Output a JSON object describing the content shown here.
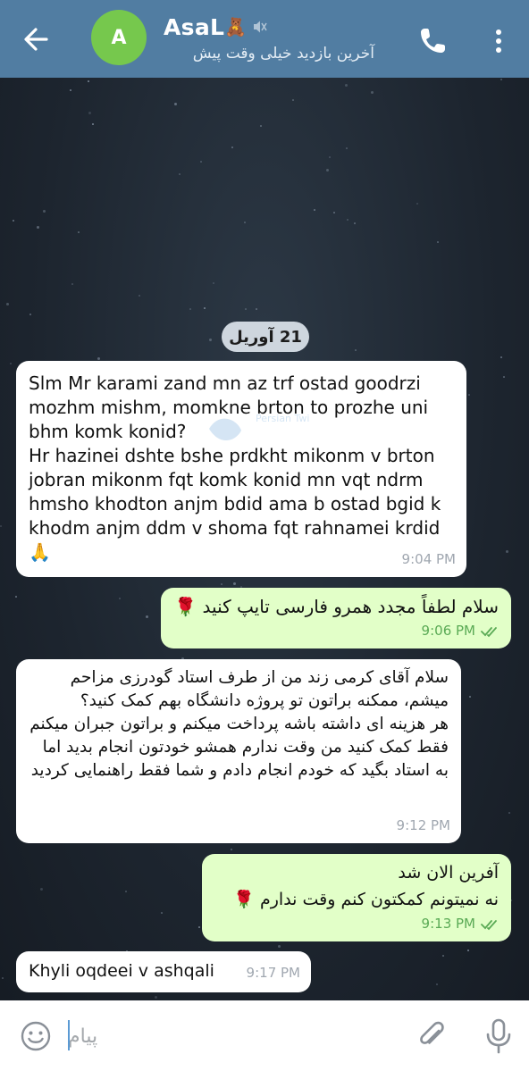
{
  "header": {
    "title": "AsaL",
    "title_emoji": "🧸",
    "subtitle": "آخرین بازدید خیلی وقت پیش",
    "avatar_letter": "A",
    "avatar_color": "#76c84d",
    "bar_color": "#517da2"
  },
  "chat": {
    "date_chip": "21 آوریل",
    "messages": [
      {
        "direction": "incoming",
        "text": "Slm Mr karami zand mn az trf ostad goodrzi mozhm mishm, momkne brton to prozhe uni bhm komk konid?\nHr hazinei dshte bshe prdkht mikonm v brton jobran mikonm fqt komk konid mn vqt ndrm hmsho khodton anjm bdid ama b ostad bgid k khodm anjm ddm v shoma fqt rahnamei krdid🙏",
        "time": "9:04 PM"
      },
      {
        "direction": "outgoing",
        "text": "سلام لطفاً مجدد همرو فارسی تایپ کنید 🌹",
        "time": "9:06 PM",
        "status": "read"
      },
      {
        "direction": "incoming",
        "text": "سلام آقای کرمی زند من از طرف استاد گودرزی مزاحم میشم، ممکنه براتون تو پروژه دانشگاه بهم کمک کنید؟\nهر هزینه ای داشته باشه پرداخت میکنم و براتون جبران میکنم فقط کمک کنید من وقت ندارم همشو خودتون انجام بدید اما به استاد بگید که خودم انجام دادم و شما فقط راهنمایی کردید",
        "time": "9:12 PM"
      },
      {
        "direction": "outgoing",
        "text": "آفرین الان شد\nنه نمیتونم کمکتون کنم وقت ندارم 🌹",
        "time": "9:13 PM",
        "status": "read"
      },
      {
        "direction": "incoming",
        "text": "Khyli oqdeei v ashqali",
        "time": "9:17 PM"
      }
    ],
    "incoming_bubble_color": "#ffffff",
    "outgoing_bubble_color": "#e2ffc8",
    "watermark_text": "Persian Twitter"
  },
  "composer": {
    "placeholder": "پیام"
  },
  "icons": {
    "back": "arrow-left-icon",
    "mute": "mute-speaker-icon",
    "call": "phone-icon",
    "menu": "vertical-dots-icon",
    "emoji": "smiley-icon",
    "attach": "paperclip-icon",
    "mic": "microphone-icon",
    "read": "double-check-icon"
  }
}
